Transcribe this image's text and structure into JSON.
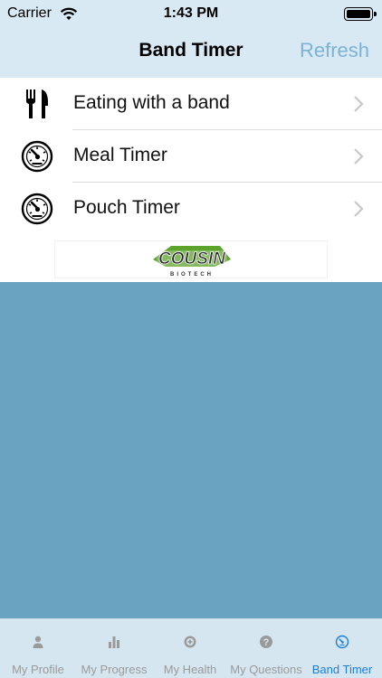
{
  "status": {
    "carrier": "Carrier",
    "time": "1:43 PM"
  },
  "nav": {
    "title": "Band Timer",
    "refresh_label": "Refresh"
  },
  "menu": {
    "items": [
      {
        "label": "Eating with a band",
        "icon": "fork-knife-icon"
      },
      {
        "label": "Meal Timer",
        "icon": "timer-dial-icon"
      },
      {
        "label": "Pouch Timer",
        "icon": "timer-dial-icon"
      }
    ]
  },
  "banner": {
    "brand_text": "COUSIN",
    "brand_subtext": "BIOTECH",
    "brand_green": "#5ca32b"
  },
  "tabs": [
    {
      "label": "My Profile",
      "icon": "person-icon"
    },
    {
      "label": "My Progress",
      "icon": "bar-chart-icon"
    },
    {
      "label": "My Health",
      "icon": "health-plus-icon"
    },
    {
      "label": "My Questions",
      "icon": "question-icon"
    },
    {
      "label": "Band Timer",
      "icon": "timer-dial-icon",
      "active": true
    }
  ],
  "colors": {
    "nav_background": "#d9e9f3",
    "accent": "#1a7fd6",
    "refresh": "#7cb3d4",
    "content_background": "#6aa2c1"
  }
}
